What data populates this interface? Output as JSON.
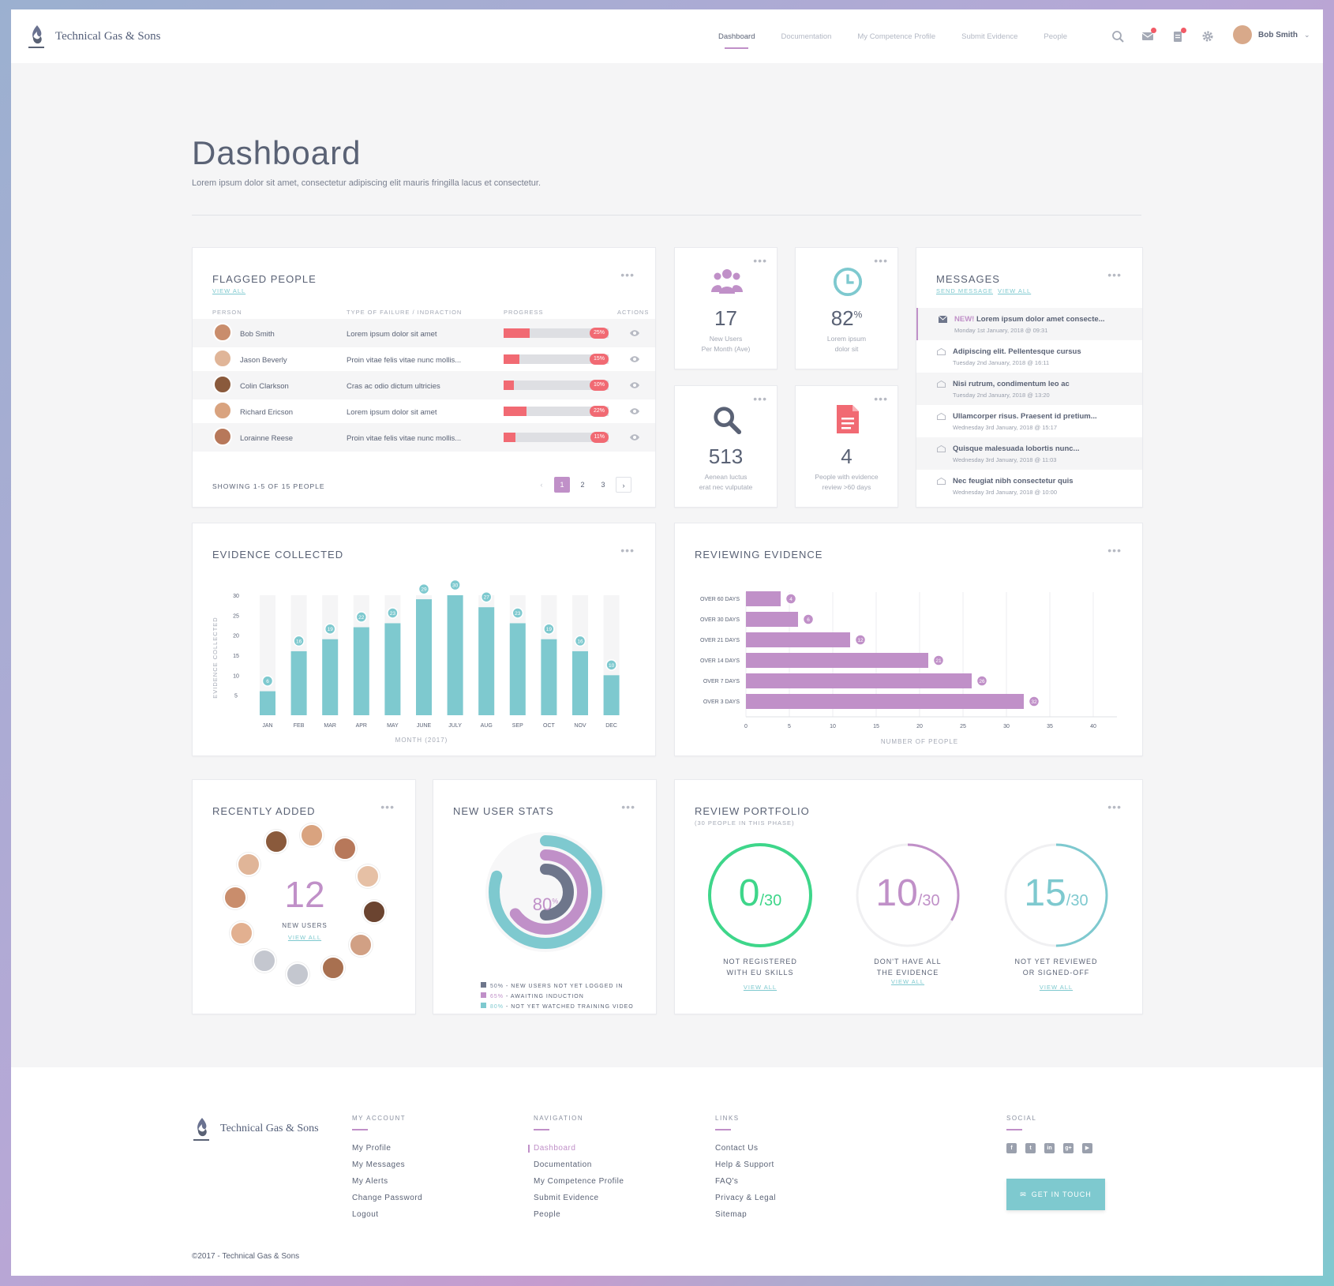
{
  "app": {
    "name": "Technical Gas & Sons"
  },
  "nav": {
    "items": [
      "Dashboard",
      "Documentation",
      "My Competence Profile",
      "Submit Evidence",
      "People"
    ],
    "active": 0
  },
  "user": {
    "name": "Bob Smith"
  },
  "page": {
    "title": "Dashboard",
    "subtitle": "Lorem ipsum dolor sit amet, consectetur adipiscing elit mauris fringilla lacus et consectetur."
  },
  "flagged": {
    "title": "FLAGGED PEOPLE",
    "view_all": "VIEW ALL",
    "columns": [
      "PERSON",
      "TYPE OF FAILURE / INDRACTION",
      "PROGRESS",
      "ACTIONS"
    ],
    "rows": [
      {
        "name": "Bob Smith",
        "failure": "Lorem ipsum dolor sit amet",
        "progress": 25,
        "label": "25%"
      },
      {
        "name": "Jason Beverly",
        "failure": "Proin vitae felis vitae nunc mollis...",
        "progress": 15,
        "label": "15%"
      },
      {
        "name": "Colin Clarkson",
        "failure": "Cras ac odio dictum ultricies",
        "progress": 10,
        "label": "10%"
      },
      {
        "name": "Richard Ericson",
        "failure": "Lorem ipsum dolor sit amet",
        "progress": 22,
        "label": "22%"
      },
      {
        "name": "Lorainne Reese",
        "failure": "Proin vitae felis vitae nunc mollis...",
        "progress": 11,
        "label": "11%"
      }
    ],
    "showing": "SHOWING 1-5 OF 15 PEOPLE",
    "pages": [
      "1",
      "2",
      "3"
    ],
    "page_prev": "‹",
    "page_next": "›"
  },
  "stats": [
    {
      "value": "17",
      "label1": "New Users",
      "label2": "Per Month (Ave)",
      "icon": "users-icon",
      "color": "#c090c8"
    },
    {
      "value": "82",
      "suffix": "%",
      "label1": "Lorem ipsum",
      "label2": "dolor sit",
      "icon": "clock-icon",
      "color": "#7ec9cf"
    },
    {
      "value": "513",
      "label1": "Aenean luctus",
      "label2": "erat nec vulputate",
      "icon": "search-icon",
      "color": "#5a6275"
    },
    {
      "value": "4",
      "label1": "People with evidence",
      "label2": "review >60 days",
      "icon": "document-icon",
      "color": "#f16a73"
    }
  ],
  "messages": {
    "title": "MESSAGES",
    "send": "SEND MESSAGE",
    "view_all": "VIEW ALL",
    "items": [
      {
        "new": "NEW!",
        "text": "Lorem ipsum dolor amet consecte...",
        "date": "Monday 1st January, 2018 @ 09:31"
      },
      {
        "new": "",
        "text": "Adipiscing elit. Pellentesque cursus",
        "date": "Tuesday 2nd January, 2018 @ 16:11"
      },
      {
        "new": "",
        "text": "Nisi rutrum, condimentum leo ac",
        "date": "Tuesday 2nd January, 2018 @ 13:20"
      },
      {
        "new": "",
        "text": "Ullamcorper risus. Praesent id pretium...",
        "date": "Wednesday 3rd January, 2018 @ 15:17"
      },
      {
        "new": "",
        "text": "Quisque malesuada lobortis nunc...",
        "date": "Wednesday 3rd January, 2018 @ 11:03"
      },
      {
        "new": "",
        "text": "Nec feugiat nibh consectetur quis",
        "date": "Wednesday 3rd January, 2018 @ 10:00"
      }
    ]
  },
  "evidence": {
    "title": "EVIDENCE COLLECTED"
  },
  "reviewing": {
    "title": "REVIEWING EVIDENCE"
  },
  "chart_data": [
    {
      "type": "bar",
      "title": "EVIDENCE COLLECTED",
      "categories": [
        "JAN",
        "FEB",
        "MAR",
        "APR",
        "MAY",
        "JUNE",
        "JULY",
        "AUG",
        "SEP",
        "OCT",
        "NOV",
        "DEC"
      ],
      "values": [
        6,
        16,
        19,
        22,
        23,
        29,
        30,
        27,
        23,
        19,
        16,
        10
      ],
      "xlabel": "MONTH (2017)",
      "ylabel": "EVIDENCE COLLECTED",
      "ylim": [
        0,
        30
      ],
      "yticks": [
        5,
        10,
        15,
        20,
        25,
        30
      ],
      "color": "#7ec9cf",
      "background_color": "#f5f5f6"
    },
    {
      "type": "bar",
      "orientation": "horizontal",
      "title": "REVIEWING EVIDENCE",
      "categories": [
        "OVER 60 DAYS",
        "OVER 30 DAYS",
        "OVER 21 DAYS",
        "OVER 14 DAYS",
        "OVER 7 DAYS",
        "OVER 3 DAYS"
      ],
      "values": [
        4,
        6,
        12,
        21,
        26,
        32
      ],
      "xlabel": "NUMBER OF PEOPLE",
      "xlim": [
        0,
        40
      ],
      "xticks": [
        0,
        5,
        10,
        15,
        20,
        25,
        30,
        35,
        40
      ],
      "color": "#c090c8"
    },
    {
      "type": "pie",
      "variant": "donut",
      "title": "NEW USER STATS",
      "center": "80%",
      "series": [
        {
          "name": "NEW USERS NOT YET LOGGED IN",
          "value": 50,
          "color": "#6e768b"
        },
        {
          "name": "AWAITING INDUCTION",
          "value": 65,
          "color": "#c090c8"
        },
        {
          "name": "NOT YET WATCHED TRAINING VIDEO",
          "value": 80,
          "color": "#7ec9cf"
        }
      ]
    }
  ],
  "recent": {
    "title": "RECENTLY ADDED",
    "count": "12",
    "label": "NEW USERS",
    "view_all": "VIEW ALL"
  },
  "newstats": {
    "title": "NEW USER STATS",
    "center": "80",
    "center_suffix": "%",
    "legend": [
      {
        "pct": "50%",
        "label": "- NEW USERS NOT YET LOGGED IN"
      },
      {
        "pct": "65%",
        "label": "- AWAITING INDUCTION"
      },
      {
        "pct": "80%",
        "label": "- NOT YET WATCHED TRAINING VIDEO"
      }
    ]
  },
  "portfolio": {
    "title": "REVIEW PORTFOLIO",
    "subtitle": "(30 PEOPLE IN THIS PHASE)",
    "items": [
      {
        "value": "0",
        "total": "/30",
        "fraction": 0,
        "label1": "NOT REGISTERED",
        "label2": "WITH EU SKILLS",
        "link": "VIEW ALL",
        "color": "#3ed68a"
      },
      {
        "value": "10",
        "total": "/30",
        "fraction": 0.333,
        "label1": "DON'T HAVE ALL",
        "label2": "THE EVIDENCE",
        "link": "VIEW ALL",
        "color": "#c090c8"
      },
      {
        "value": "15",
        "total": "/30",
        "fraction": 0.5,
        "label1": "NOT YET REVIEWED",
        "label2": "OR SIGNED-OFF",
        "link": "VIEW ALL",
        "color": "#7ec9cf"
      }
    ]
  },
  "footer": {
    "account": {
      "title": "MY ACCOUNT",
      "links": [
        "My Profile",
        "My Messages",
        "My Alerts",
        "Change Password",
        "Logout"
      ]
    },
    "navigation": {
      "title": "NAVIGATION",
      "links": [
        "Dashboard",
        "Documentation",
        "My Competence Profile",
        "Submit Evidence",
        "People"
      ]
    },
    "links": {
      "title": "LINKS",
      "links": [
        "Contact Us",
        "Help & Support",
        "FAQ's",
        "Privacy & Legal",
        "Sitemap"
      ]
    },
    "social": {
      "title": "SOCIAL",
      "icons": [
        "facebook-icon",
        "twitter-icon",
        "linkedin-icon",
        "google-plus-icon",
        "youtube-icon"
      ]
    },
    "cta": "GET IN TOUCH",
    "copyright": "©2017 - Technical Gas & Sons"
  },
  "more": "•••"
}
